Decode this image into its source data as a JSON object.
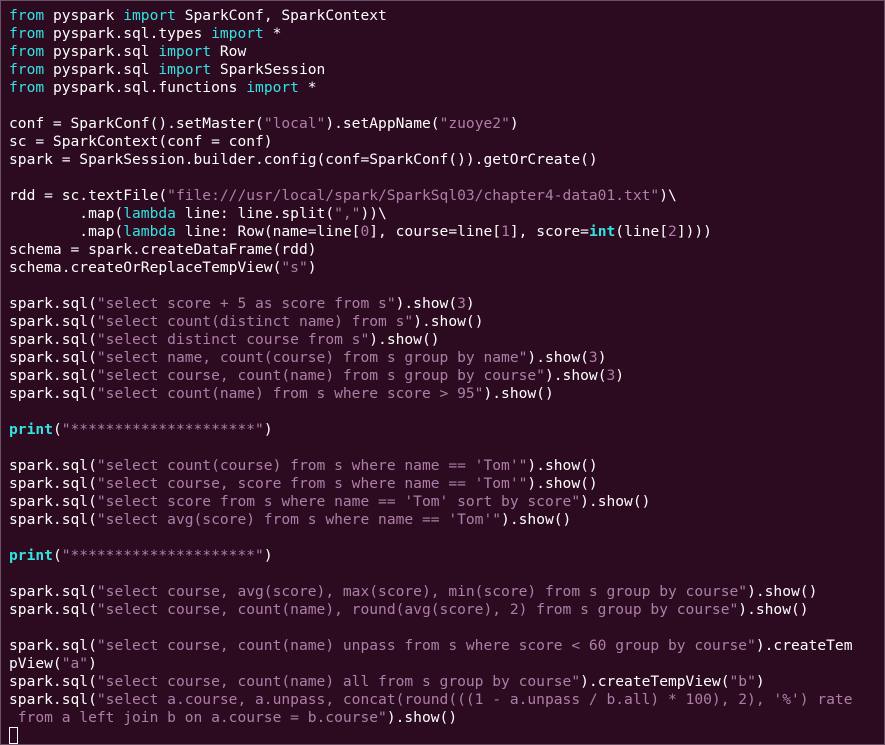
{
  "colors": {
    "background": "#2c0a20",
    "text": "#ffffff",
    "keyword": "#34e2e2",
    "string": "#ad7fa8",
    "number": "#ad7fa8"
  },
  "cursor_icon": "block-cursor",
  "lines": [
    [
      [
        "kw",
        "from"
      ],
      [
        "t",
        " pyspark "
      ],
      [
        "kw",
        "import"
      ],
      [
        "t",
        " SparkConf, SparkContext"
      ]
    ],
    [
      [
        "kw",
        "from"
      ],
      [
        "t",
        " pyspark.sql.types "
      ],
      [
        "kw",
        "import"
      ],
      [
        "t",
        " *"
      ]
    ],
    [
      [
        "kw",
        "from"
      ],
      [
        "t",
        " pyspark.sql "
      ],
      [
        "kw",
        "import"
      ],
      [
        "t",
        " Row"
      ]
    ],
    [
      [
        "kw",
        "from"
      ],
      [
        "t",
        " pyspark.sql "
      ],
      [
        "kw",
        "import"
      ],
      [
        "t",
        " SparkSession"
      ]
    ],
    [
      [
        "kw",
        "from"
      ],
      [
        "t",
        " pyspark.sql.functions "
      ],
      [
        "kw",
        "import"
      ],
      [
        "t",
        " *"
      ]
    ],
    [],
    [
      [
        "t",
        "conf = SparkConf().setMaster("
      ],
      [
        "str",
        "\"local\""
      ],
      [
        "t",
        ").setAppName("
      ],
      [
        "str",
        "\"zuoye2\""
      ],
      [
        "t",
        ")"
      ]
    ],
    [
      [
        "t",
        "sc = SparkContext(conf = conf)"
      ]
    ],
    [
      [
        "t",
        "spark = SparkSession.builder.config(conf=SparkConf()).getOrCreate()"
      ]
    ],
    [],
    [
      [
        "t",
        "rdd = sc.textFile("
      ],
      [
        "str",
        "\"file:///usr/local/spark/SparkSql03/chapter4-data01.txt\""
      ],
      [
        "t",
        ")\\"
      ]
    ],
    [
      [
        "t",
        "        .map("
      ],
      [
        "kw",
        "lambda"
      ],
      [
        "t",
        " line: line.split("
      ],
      [
        "str",
        "\",\""
      ],
      [
        "t",
        "))\\"
      ]
    ],
    [
      [
        "t",
        "        .map("
      ],
      [
        "kw",
        "lambda"
      ],
      [
        "t",
        " line: Row(name=line["
      ],
      [
        "num",
        "0"
      ],
      [
        "t",
        "], course=line["
      ],
      [
        "num",
        "1"
      ],
      [
        "t",
        "], score="
      ],
      [
        "bi",
        "int"
      ],
      [
        "t",
        "(line["
      ],
      [
        "num",
        "2"
      ],
      [
        "t",
        "])))"
      ]
    ],
    [
      [
        "t",
        "schema = spark.createDataFrame(rdd)"
      ]
    ],
    [
      [
        "t",
        "schema.createOrReplaceTempView("
      ],
      [
        "str",
        "\"s\""
      ],
      [
        "t",
        ")"
      ]
    ],
    [],
    [
      [
        "t",
        "spark.sql("
      ],
      [
        "str",
        "\"select score + 5 as score from s\""
      ],
      [
        "t",
        ").show("
      ],
      [
        "num",
        "3"
      ],
      [
        "t",
        ")"
      ]
    ],
    [
      [
        "t",
        "spark.sql("
      ],
      [
        "str",
        "\"select count(distinct name) from s\""
      ],
      [
        "t",
        ").show()"
      ]
    ],
    [
      [
        "t",
        "spark.sql("
      ],
      [
        "str",
        "\"select distinct course from s\""
      ],
      [
        "t",
        ").show()"
      ]
    ],
    [
      [
        "t",
        "spark.sql("
      ],
      [
        "str",
        "\"select name, count(course) from s group by name\""
      ],
      [
        "t",
        ").show("
      ],
      [
        "num",
        "3"
      ],
      [
        "t",
        ")"
      ]
    ],
    [
      [
        "t",
        "spark.sql("
      ],
      [
        "str",
        "\"select course, count(name) from s group by course\""
      ],
      [
        "t",
        ").show("
      ],
      [
        "num",
        "3"
      ],
      [
        "t",
        ")"
      ]
    ],
    [
      [
        "t",
        "spark.sql("
      ],
      [
        "str",
        "\"select count(name) from s where score > 95\""
      ],
      [
        "t",
        ").show()"
      ]
    ],
    [],
    [
      [
        "bi",
        "print"
      ],
      [
        "t",
        "("
      ],
      [
        "str",
        "\"*********************\""
      ],
      [
        "t",
        ")"
      ]
    ],
    [],
    [
      [
        "t",
        "spark.sql("
      ],
      [
        "str",
        "\"select count(course) from s where name == 'Tom'\""
      ],
      [
        "t",
        ").show()"
      ]
    ],
    [
      [
        "t",
        "spark.sql("
      ],
      [
        "str",
        "\"select course, score from s where name == 'Tom'\""
      ],
      [
        "t",
        ").show()"
      ]
    ],
    [
      [
        "t",
        "spark.sql("
      ],
      [
        "str",
        "\"select score from s where name == 'Tom' sort by score\""
      ],
      [
        "t",
        ").show()"
      ]
    ],
    [
      [
        "t",
        "spark.sql("
      ],
      [
        "str",
        "\"select avg(score) from s where name == 'Tom'\""
      ],
      [
        "t",
        ").show()"
      ]
    ],
    [],
    [
      [
        "bi",
        "print"
      ],
      [
        "t",
        "("
      ],
      [
        "str",
        "\"*********************\""
      ],
      [
        "t",
        ")"
      ]
    ],
    [],
    [
      [
        "t",
        "spark.sql("
      ],
      [
        "str",
        "\"select course, avg(score), max(score), min(score) from s group by course\""
      ],
      [
        "t",
        ").show()"
      ]
    ],
    [
      [
        "t",
        "spark.sql("
      ],
      [
        "str",
        "\"select course, count(name), round(avg(score), 2) from s group by course\""
      ],
      [
        "t",
        ").show()"
      ]
    ],
    [],
    [
      [
        "t",
        "spark.sql("
      ],
      [
        "str",
        "\"select course, count(name) unpass from s where score < 60 group by course\""
      ],
      [
        "t",
        ").createTem"
      ]
    ],
    [
      [
        "t",
        "pView("
      ],
      [
        "str",
        "\"a\""
      ],
      [
        "t",
        ")"
      ]
    ],
    [
      [
        "t",
        "spark.sql("
      ],
      [
        "str",
        "\"select course, count(name) all from s group by course\""
      ],
      [
        "t",
        ").createTempView("
      ],
      [
        "str",
        "\"b\""
      ],
      [
        "t",
        ")"
      ]
    ],
    [
      [
        "t",
        "spark.sql("
      ],
      [
        "str",
        "\"select a.course, a.unpass, concat(round(((1 - a.unpass / b.all) * 100), 2), '%') rate"
      ]
    ],
    [
      [
        "str",
        " from a left join b on a.course = b.course\""
      ],
      [
        "t",
        ").show()"
      ]
    ]
  ]
}
